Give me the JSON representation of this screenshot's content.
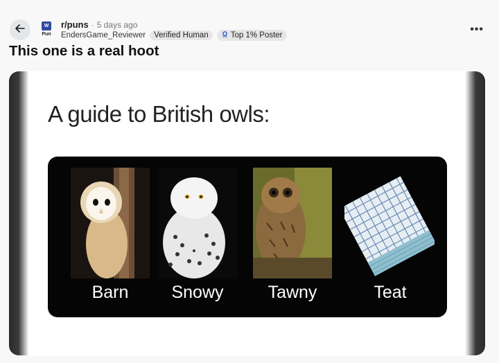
{
  "post": {
    "subreddit": "r/puns",
    "separator": "·",
    "time_ago": "5 days ago",
    "username": "EndersGame_Reviewer",
    "flair_verified": "Verified Human",
    "flair_top": "Top 1% Poster",
    "title": "This one is a real hoot",
    "more": "•••",
    "sub_icon_text": "Pun"
  },
  "image": {
    "heading": "A guide to British owls:",
    "items": [
      {
        "label": "Barn"
      },
      {
        "label": "Snowy"
      },
      {
        "label": "Tawny"
      },
      {
        "label": "Teat"
      }
    ]
  },
  "colors": {
    "accent": "#2f4aa0",
    "flair_bg": "#e6e6e6",
    "page_bg": "#f8f8f8"
  },
  "icons": {
    "back": "arrow-left-icon",
    "more": "more-options-icon",
    "flair_top": "badge-icon"
  }
}
